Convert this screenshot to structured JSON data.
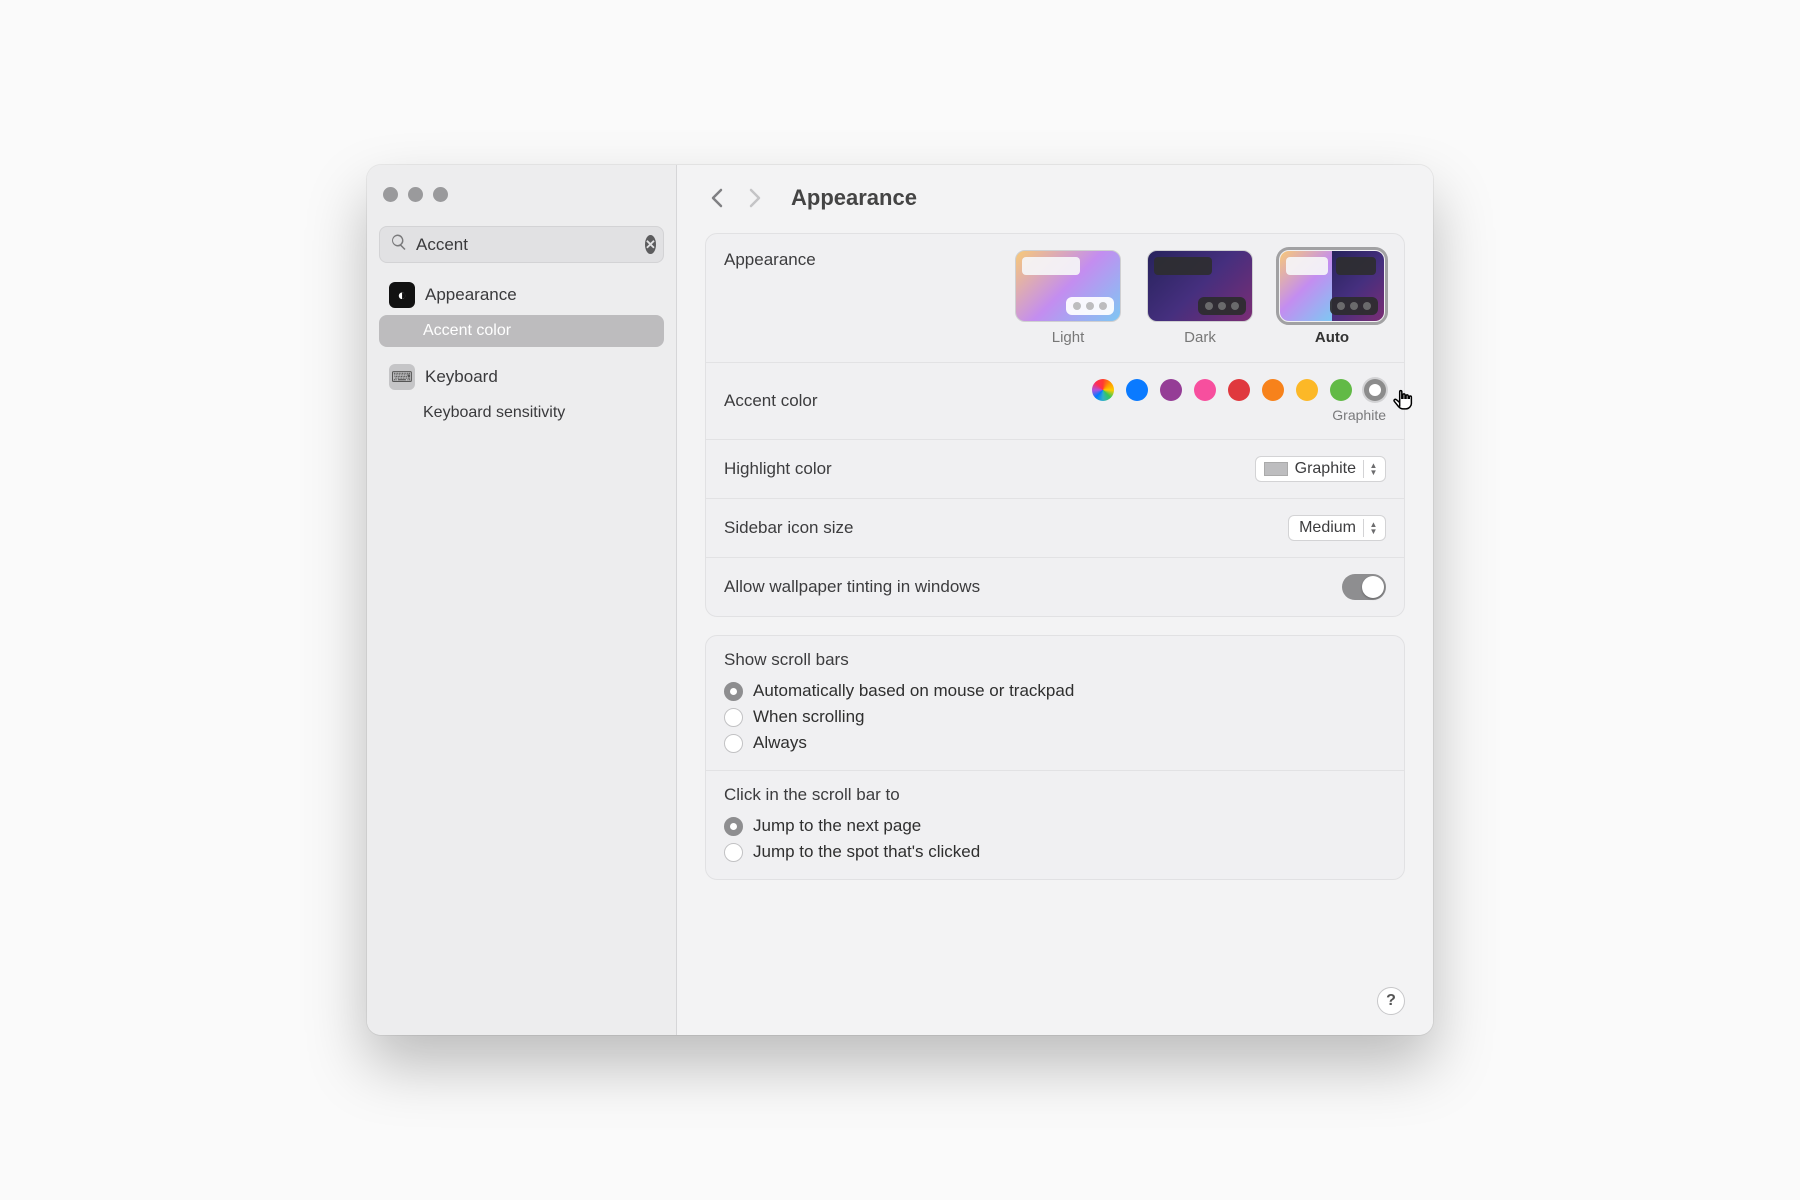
{
  "sidebar": {
    "search_value": "Accent",
    "items": [
      {
        "label": "Appearance",
        "sub": [
          {
            "label": "Accent color"
          }
        ]
      },
      {
        "label": "Keyboard",
        "sub": [
          {
            "label": "Keyboard sensitivity"
          }
        ]
      }
    ]
  },
  "header": {
    "title": "Appearance"
  },
  "appearance": {
    "label": "Appearance",
    "options": [
      {
        "label": "Light"
      },
      {
        "label": "Dark"
      },
      {
        "label": "Auto"
      }
    ],
    "selected": "Auto"
  },
  "accent": {
    "label": "Accent color",
    "colors": [
      {
        "name": "Multicolor",
        "css": "multicolor"
      },
      {
        "name": "Blue",
        "hex": "#0a7aff"
      },
      {
        "name": "Purple",
        "hex": "#953d96"
      },
      {
        "name": "Pink",
        "hex": "#f74f9e"
      },
      {
        "name": "Red",
        "hex": "#e0383e"
      },
      {
        "name": "Orange",
        "hex": "#f7821b"
      },
      {
        "name": "Yellow",
        "hex": "#fcb827"
      },
      {
        "name": "Green",
        "hex": "#62ba46"
      },
      {
        "name": "Graphite",
        "hex": "#8c8c8c"
      }
    ],
    "selected": "Graphite",
    "selected_label": "Graphite"
  },
  "highlight": {
    "label": "Highlight color",
    "value": "Graphite"
  },
  "sidebar_icon": {
    "label": "Sidebar icon size",
    "value": "Medium"
  },
  "tinting": {
    "label": "Allow wallpaper tinting in windows",
    "value": true
  },
  "scroll_bars": {
    "title": "Show scroll bars",
    "options": [
      "Automatically based on mouse or trackpad",
      "When scrolling",
      "Always"
    ],
    "selected": 0
  },
  "scroll_click": {
    "title": "Click in the scroll bar to",
    "options": [
      "Jump to the next page",
      "Jump to the spot that's clicked"
    ],
    "selected": 0
  },
  "help_tooltip": "?"
}
